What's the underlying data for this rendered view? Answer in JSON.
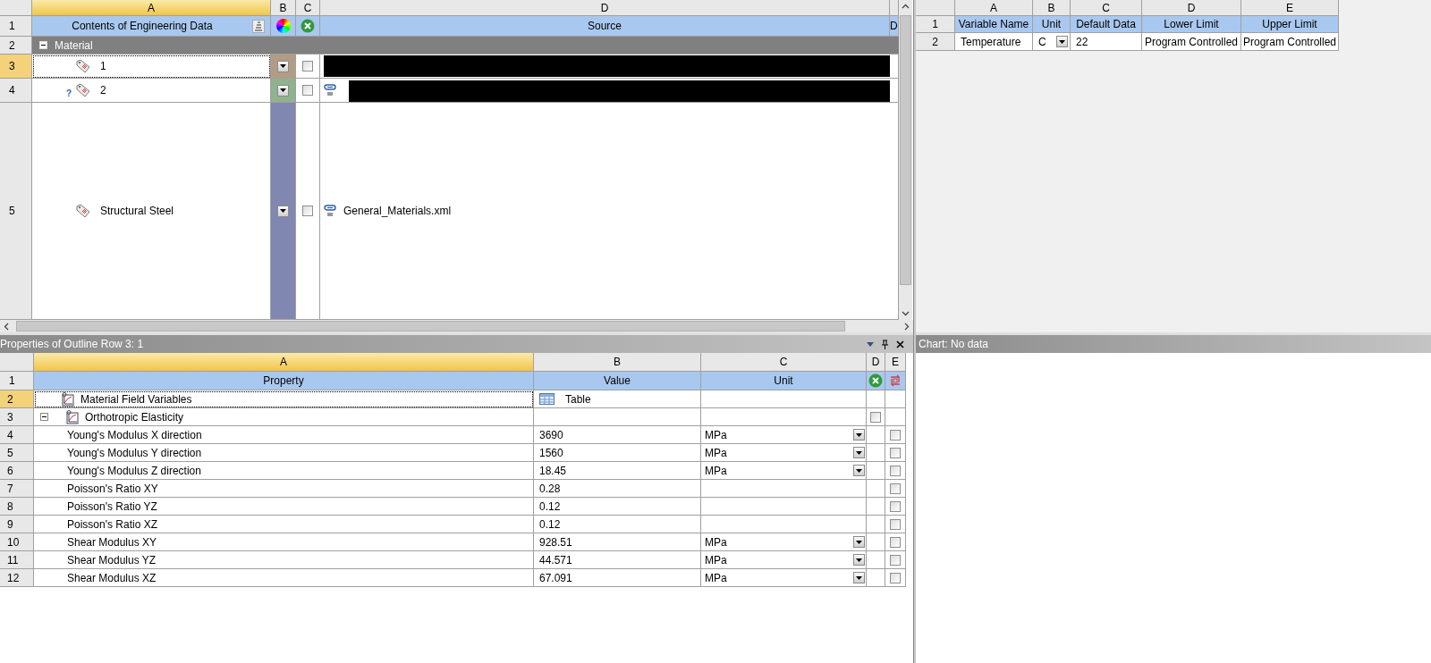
{
  "outline": {
    "columns": [
      {
        "letter": "A",
        "selected": true
      },
      {
        "letter": "B",
        "selected": false
      },
      {
        "letter": "C",
        "selected": false
      },
      {
        "letter": "D",
        "selected": false
      }
    ],
    "header_row": {
      "number": "1",
      "title": "Contents of Engineering Data",
      "source": "Source",
      "column_5": "D"
    },
    "group": {
      "number": "2",
      "label": "Material",
      "expanded": true
    },
    "rows": [
      {
        "number": "3",
        "name": "1",
        "selected": true,
        "color": "#b39c86",
        "included": false,
        "linked": false,
        "redacted": true
      },
      {
        "number": "4",
        "name": "2",
        "status_mark": "?",
        "selected": false,
        "color": "#8fb28f",
        "included": false,
        "linked": true,
        "redacted": true
      },
      {
        "number": "5",
        "name": "Structural Steel",
        "selected": false,
        "color": "#8087b0",
        "included": false,
        "linked": true,
        "redacted": false,
        "source": "General_Materials.xml"
      }
    ]
  },
  "properties": {
    "title": "Properties of Outline Row 3: 1",
    "columns": [
      {
        "letter": "A",
        "selected": true
      },
      {
        "letter": "B",
        "selected": false
      },
      {
        "letter": "C",
        "selected": false
      },
      {
        "letter": "D",
        "selected": false
      },
      {
        "letter": "E",
        "selected": false
      }
    ],
    "header_row": {
      "number": "1",
      "property": "Property",
      "value": "Value",
      "unit": "Unit"
    },
    "rows": [
      {
        "number": "2",
        "kind": "field-table",
        "property": "Material Field Variables",
        "value": "Table",
        "selected": true
      },
      {
        "number": "3",
        "kind": "group",
        "property": "Orthotropic Elasticity",
        "expanded": true,
        "checked": false,
        "selected": false
      },
      {
        "number": "4",
        "kind": "param",
        "property": "Young's Modulus X direction",
        "value": "3690",
        "unit": "MPa",
        "checked": false,
        "selected": false
      },
      {
        "number": "5",
        "kind": "param",
        "property": "Young's Modulus Y direction",
        "value": "1560",
        "unit": "MPa",
        "checked": false,
        "selected": false
      },
      {
        "number": "6",
        "kind": "param",
        "property": "Young's Modulus Z direction",
        "value": "18.45",
        "unit": "MPa",
        "checked": false,
        "selected": false
      },
      {
        "number": "7",
        "kind": "param",
        "property": "Poisson's Ratio XY",
        "value": "0.28",
        "checked": false,
        "selected": false
      },
      {
        "number": "8",
        "kind": "param",
        "property": "Poisson's Ratio YZ",
        "value": "0.12",
        "checked": false,
        "selected": false
      },
      {
        "number": "9",
        "kind": "param",
        "property": "Poisson's Ratio XZ",
        "value": "0.12",
        "checked": false,
        "selected": false
      },
      {
        "number": "10",
        "kind": "param",
        "property": "Shear Modulus XY",
        "value": "928.51",
        "unit": "MPa",
        "checked": false,
        "selected": false
      },
      {
        "number": "11",
        "kind": "param",
        "property": "Shear Modulus YZ",
        "value": "44.571",
        "unit": "MPa",
        "checked": false,
        "selected": false
      },
      {
        "number": "12",
        "kind": "param",
        "property": "Shear Modulus XZ",
        "value": "67.091",
        "unit": "MPa",
        "checked": false,
        "selected": false
      }
    ]
  },
  "variables": {
    "columns": [
      "A",
      "B",
      "C",
      "D",
      "E"
    ],
    "header_row": {
      "number": "1",
      "cells": [
        "Variable Name",
        "Unit",
        "Default Data",
        "Lower Limit",
        "Upper Limit"
      ]
    },
    "rows": [
      {
        "number": "2",
        "variable": "Temperature",
        "unit": "C",
        "default_data": "22",
        "lower_limit": "Program Controlled",
        "upper_limit": "Program Controlled"
      }
    ]
  },
  "chart": {
    "title": "Chart: No data"
  }
}
